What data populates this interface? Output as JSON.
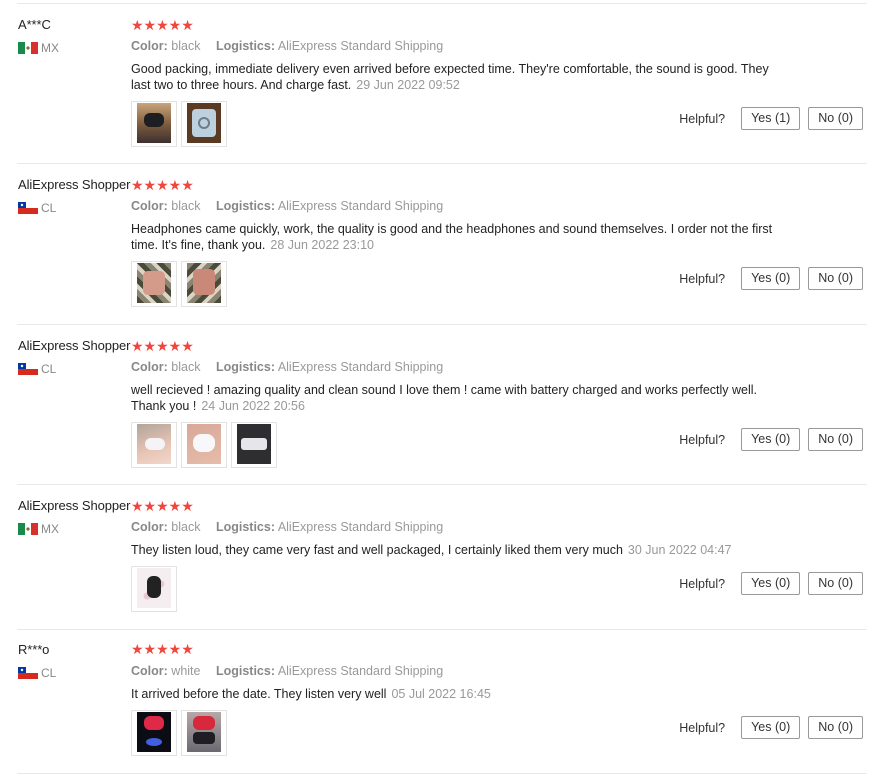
{
  "helpful_label": "Helpful?",
  "color_label": "Color:",
  "logistics_label": "Logistics:",
  "reviews": [
    {
      "user": "A***C",
      "country_code": "MX",
      "rating": "★★★★★",
      "color": "black",
      "logistics": "AliExpress Standard Shipping",
      "text": "Good packing, immediate delivery even arrived before expected time. They're comfortable, the sound is good. They last two to three hours. And charge fast.",
      "date": "29 Jun 2022 09:52",
      "yes": "Yes (1)",
      "no": "No (0)",
      "photos": 2
    },
    {
      "user": "AliExpress Shopper",
      "country_code": "CL",
      "rating": "★★★★★",
      "color": "black",
      "logistics": "AliExpress Standard Shipping",
      "text": "Headphones came quickly, work, the quality is good and the headphones and sound themselves. I order not the first time. It's fine, thank you.",
      "date": "28 Jun 2022 23:10",
      "yes": "Yes (0)",
      "no": "No (0)",
      "photos": 2
    },
    {
      "user": "AliExpress Shopper",
      "country_code": "CL",
      "rating": "★★★★★",
      "color": "black",
      "logistics": "AliExpress Standard Shipping",
      "text": "well recieved ! amazing quality and clean sound I love them ! came with battery charged and works perfectly well. Thank you !",
      "date": "24 Jun 2022 20:56",
      "yes": "Yes (0)",
      "no": "No (0)",
      "photos": 3
    },
    {
      "user": "AliExpress Shopper",
      "country_code": "MX",
      "rating": "★★★★★",
      "color": "black",
      "logistics": "AliExpress Standard Shipping",
      "text": "They listen loud, they came very fast and well packaged, I certainly liked them very much",
      "date": "30 Jun 2022 04:47",
      "yes": "Yes (0)",
      "no": "No (0)",
      "photos": 1
    },
    {
      "user": "R***o",
      "country_code": "CL",
      "rating": "★★★★★",
      "color": "white",
      "logistics": "AliExpress Standard Shipping",
      "text": "It arrived before the date. They listen very well",
      "date": "05 Jul 2022 16:45",
      "yes": "Yes (0)",
      "no": "No (0)",
      "photos": 2
    }
  ],
  "colors": {
    "star": "#f0463c",
    "muted": "#999999",
    "divider": "#e8e8e8"
  }
}
